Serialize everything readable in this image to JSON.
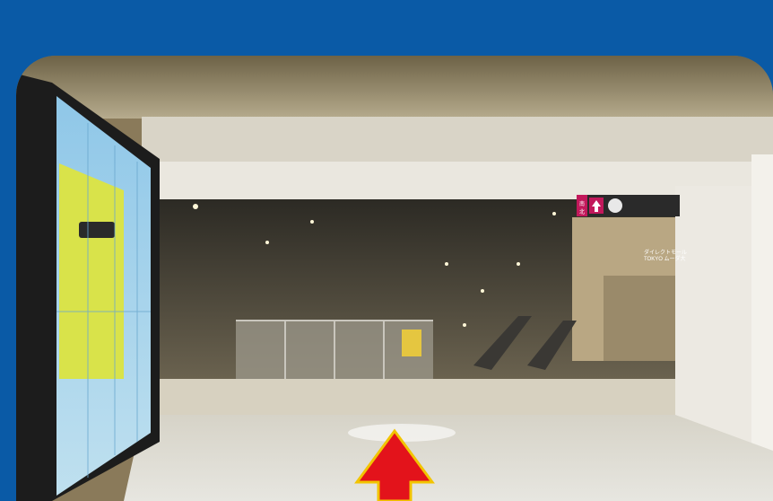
{
  "scene": {
    "background_color": "#0a5aa6",
    "description_alt": "",
    "arrow_color": "#e3131b",
    "arrow_outline_color": "#f2c400"
  },
  "overhead_sign": {
    "arrow_icon": "up-arrow-icon",
    "side_label": "南北",
    "line1": "ダイレクトモール",
    "line2": "TOKYO ムーダ大"
  }
}
